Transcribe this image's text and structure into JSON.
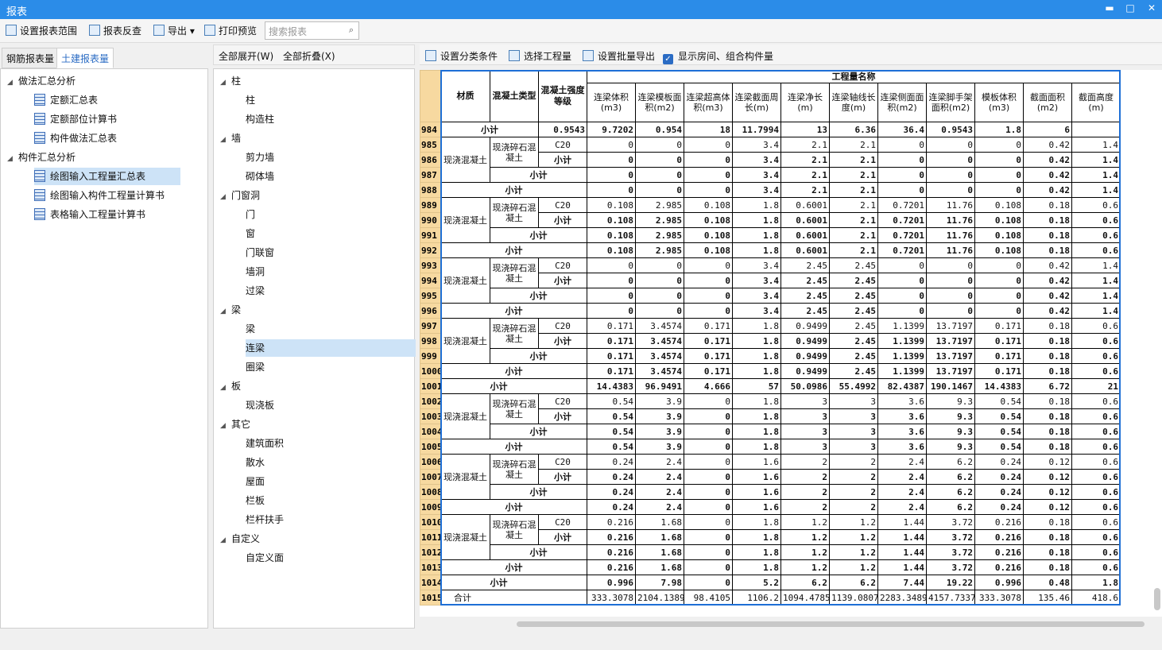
{
  "window": {
    "title": "报表",
    "btn_min": "▬",
    "btn_max": "□",
    "btn_close": "✕"
  },
  "toolbar": {
    "set_range": "设置报表范围",
    "reverse_check": "报表反查",
    "export": "导出",
    "export_arrow": "▾",
    "print_preview": "打印预览",
    "search_placeholder": "搜索报表",
    "search_icon": "⌕"
  },
  "left_tabs": [
    "钢筋报表量",
    "土建报表量"
  ],
  "left_tree": [
    {
      "label": "做法汇总分析",
      "level": 0,
      "expanded": true
    },
    {
      "label": "定额汇总表",
      "level": 1
    },
    {
      "label": "定额部位计算书",
      "level": 1
    },
    {
      "label": "构件做法汇总表",
      "level": 1
    },
    {
      "label": "构件汇总分析",
      "level": 0,
      "expanded": true
    },
    {
      "label": "绘图输入工程量汇总表",
      "level": 1,
      "selected": true
    },
    {
      "label": "绘图输入构件工程量计算书",
      "level": 1
    },
    {
      "label": "表格输入工程量计算书",
      "level": 1
    }
  ],
  "mid_header": {
    "expand_all": "全部展开(W)",
    "collapse_all": "全部折叠(X)"
  },
  "mid_tree": [
    {
      "label": "柱",
      "group": true
    },
    {
      "label": "柱"
    },
    {
      "label": "构造柱"
    },
    {
      "label": "墙",
      "group": true
    },
    {
      "label": "剪力墙"
    },
    {
      "label": "砌体墙"
    },
    {
      "label": "门窗洞",
      "group": true
    },
    {
      "label": "门"
    },
    {
      "label": "窗"
    },
    {
      "label": "门联窗"
    },
    {
      "label": "墙洞"
    },
    {
      "label": "过梁"
    },
    {
      "label": "梁",
      "group": true
    },
    {
      "label": "梁"
    },
    {
      "label": "连梁",
      "selected": true
    },
    {
      "label": "圈梁"
    },
    {
      "label": "板",
      "group": true
    },
    {
      "label": "现浇板"
    },
    {
      "label": "其它",
      "group": true
    },
    {
      "label": "建筑面积"
    },
    {
      "label": "散水"
    },
    {
      "label": "屋面"
    },
    {
      "label": "栏板"
    },
    {
      "label": "栏杆扶手"
    },
    {
      "label": "自定义",
      "group": true
    },
    {
      "label": "自定义面"
    }
  ],
  "right_toolbar": {
    "set_condition": "设置分类条件",
    "select_qty": "选择工程量",
    "batch_export": "设置批量导出",
    "show_rooms": "显示房间、组合构件量",
    "show_rooms_checked": true,
    "check_mark": "✓"
  },
  "table": {
    "group_header": "工程量名称",
    "headers": [
      "材质",
      "混凝土类型",
      "混凝土强度等级"
    ],
    "qty_headers": [
      "连梁体积(m3)",
      "连梁模板面积(m2)",
      "连梁超高体积(m3)",
      "连梁截面周长(m)",
      "连梁净长(m)",
      "连梁轴线长度(m)",
      "连梁侧面面积(m2)",
      "连梁脚手架面积(m2)",
      "模板体积(m3)",
      "截面面积(m2)",
      "截面高度(m)"
    ],
    "mat_text": "现浇混凝土",
    "conc_text": "现浇碎石混凝土",
    "subtotal": "小计",
    "total": "合计",
    "rows": [
      {
        "n": "984",
        "kind": "sub2",
        "v": [
          "0.9543",
          "9.7202",
          "0.954",
          "18",
          "11.7994",
          "13",
          "6.36",
          "36.4",
          "0.9543",
          "1.8",
          "6"
        ]
      },
      {
        "n": "985",
        "kind": "grade",
        "grade": "C20",
        "v": [
          "0",
          "0",
          "0",
          "3.4",
          "2.1",
          "2.1",
          "0",
          "0",
          "0",
          "0.42",
          "1.4"
        ]
      },
      {
        "n": "986",
        "kind": "sub3",
        "v": [
          "0",
          "0",
          "0",
          "3.4",
          "2.1",
          "2.1",
          "0",
          "0",
          "0",
          "0.42",
          "1.4"
        ]
      },
      {
        "n": "987",
        "kind": "sub2",
        "v": [
          "0",
          "0",
          "0",
          "3.4",
          "2.1",
          "2.1",
          "0",
          "0",
          "0",
          "0.42",
          "1.4"
        ]
      },
      {
        "n": "988",
        "kind": "sub1",
        "v": [
          "0",
          "0",
          "0",
          "3.4",
          "2.1",
          "2.1",
          "0",
          "0",
          "0",
          "0.42",
          "1.4"
        ]
      },
      {
        "n": "989",
        "kind": "grade",
        "grade": "C20",
        "v": [
          "0.108",
          "2.985",
          "0.108",
          "1.8",
          "0.6001",
          "2.1",
          "0.7201",
          "11.76",
          "0.108",
          "0.18",
          "0.6"
        ]
      },
      {
        "n": "990",
        "kind": "sub3",
        "v": [
          "0.108",
          "2.985",
          "0.108",
          "1.8",
          "0.6001",
          "2.1",
          "0.7201",
          "11.76",
          "0.108",
          "0.18",
          "0.6"
        ]
      },
      {
        "n": "991",
        "kind": "sub2",
        "v": [
          "0.108",
          "2.985",
          "0.108",
          "1.8",
          "0.6001",
          "2.1",
          "0.7201",
          "11.76",
          "0.108",
          "0.18",
          "0.6"
        ]
      },
      {
        "n": "992",
        "kind": "sub1",
        "v": [
          "0.108",
          "2.985",
          "0.108",
          "1.8",
          "0.6001",
          "2.1",
          "0.7201",
          "11.76",
          "0.108",
          "0.18",
          "0.6"
        ]
      },
      {
        "n": "993",
        "kind": "grade",
        "grade": "C20",
        "v": [
          "0",
          "0",
          "0",
          "3.4",
          "2.45",
          "2.45",
          "0",
          "0",
          "0",
          "0.42",
          "1.4"
        ]
      },
      {
        "n": "994",
        "kind": "sub3",
        "v": [
          "0",
          "0",
          "0",
          "3.4",
          "2.45",
          "2.45",
          "0",
          "0",
          "0",
          "0.42",
          "1.4"
        ]
      },
      {
        "n": "995",
        "kind": "sub2",
        "v": [
          "0",
          "0",
          "0",
          "3.4",
          "2.45",
          "2.45",
          "0",
          "0",
          "0",
          "0.42",
          "1.4"
        ]
      },
      {
        "n": "996",
        "kind": "sub1",
        "v": [
          "0",
          "0",
          "0",
          "3.4",
          "2.45",
          "2.45",
          "0",
          "0",
          "0",
          "0.42",
          "1.4"
        ]
      },
      {
        "n": "997",
        "kind": "grade",
        "grade": "C20",
        "v": [
          "0.171",
          "3.4574",
          "0.171",
          "1.8",
          "0.9499",
          "2.45",
          "1.1399",
          "13.7197",
          "0.171",
          "0.18",
          "0.6"
        ]
      },
      {
        "n": "998",
        "kind": "sub3",
        "v": [
          "0.171",
          "3.4574",
          "0.171",
          "1.8",
          "0.9499",
          "2.45",
          "1.1399",
          "13.7197",
          "0.171",
          "0.18",
          "0.6"
        ]
      },
      {
        "n": "999",
        "kind": "sub2",
        "v": [
          "0.171",
          "3.4574",
          "0.171",
          "1.8",
          "0.9499",
          "2.45",
          "1.1399",
          "13.7197",
          "0.171",
          "0.18",
          "0.6"
        ]
      },
      {
        "n": "1000",
        "kind": "sub1",
        "v": [
          "0.171",
          "3.4574",
          "0.171",
          "1.8",
          "0.9499",
          "2.45",
          "1.1399",
          "13.7197",
          "0.171",
          "0.18",
          "0.6"
        ]
      },
      {
        "n": "1001",
        "kind": "sub0",
        "v": [
          "14.4383",
          "96.9491",
          "4.666",
          "57",
          "50.0986",
          "55.4992",
          "82.4387",
          "190.1467",
          "14.4383",
          "6.72",
          "21"
        ]
      },
      {
        "n": "1002",
        "kind": "grade",
        "grade": "C20",
        "v": [
          "0.54",
          "3.9",
          "0",
          "1.8",
          "3",
          "3",
          "3.6",
          "9.3",
          "0.54",
          "0.18",
          "0.6"
        ]
      },
      {
        "n": "1003",
        "kind": "sub3",
        "v": [
          "0.54",
          "3.9",
          "0",
          "1.8",
          "3",
          "3",
          "3.6",
          "9.3",
          "0.54",
          "0.18",
          "0.6"
        ]
      },
      {
        "n": "1004",
        "kind": "sub2",
        "v": [
          "0.54",
          "3.9",
          "0",
          "1.8",
          "3",
          "3",
          "3.6",
          "9.3",
          "0.54",
          "0.18",
          "0.6"
        ]
      },
      {
        "n": "1005",
        "kind": "sub1",
        "v": [
          "0.54",
          "3.9",
          "0",
          "1.8",
          "3",
          "3",
          "3.6",
          "9.3",
          "0.54",
          "0.18",
          "0.6"
        ]
      },
      {
        "n": "1006",
        "kind": "grade",
        "grade": "C20",
        "v": [
          "0.24",
          "2.4",
          "0",
          "1.6",
          "2",
          "2",
          "2.4",
          "6.2",
          "0.24",
          "0.12",
          "0.6"
        ]
      },
      {
        "n": "1007",
        "kind": "sub3",
        "v": [
          "0.24",
          "2.4",
          "0",
          "1.6",
          "2",
          "2",
          "2.4",
          "6.2",
          "0.24",
          "0.12",
          "0.6"
        ]
      },
      {
        "n": "1008",
        "kind": "sub2",
        "v": [
          "0.24",
          "2.4",
          "0",
          "1.6",
          "2",
          "2",
          "2.4",
          "6.2",
          "0.24",
          "0.12",
          "0.6"
        ]
      },
      {
        "n": "1009",
        "kind": "sub1",
        "v": [
          "0.24",
          "2.4",
          "0",
          "1.6",
          "2",
          "2",
          "2.4",
          "6.2",
          "0.24",
          "0.12",
          "0.6"
        ]
      },
      {
        "n": "1010",
        "kind": "grade",
        "grade": "C20",
        "v": [
          "0.216",
          "1.68",
          "0",
          "1.8",
          "1.2",
          "1.2",
          "1.44",
          "3.72",
          "0.216",
          "0.18",
          "0.6"
        ]
      },
      {
        "n": "1011",
        "kind": "sub3",
        "v": [
          "0.216",
          "1.68",
          "0",
          "1.8",
          "1.2",
          "1.2",
          "1.44",
          "3.72",
          "0.216",
          "0.18",
          "0.6"
        ]
      },
      {
        "n": "1012",
        "kind": "sub2",
        "v": [
          "0.216",
          "1.68",
          "0",
          "1.8",
          "1.2",
          "1.2",
          "1.44",
          "3.72",
          "0.216",
          "0.18",
          "0.6"
        ]
      },
      {
        "n": "1013",
        "kind": "sub1",
        "v": [
          "0.216",
          "1.68",
          "0",
          "1.8",
          "1.2",
          "1.2",
          "1.44",
          "3.72",
          "0.216",
          "0.18",
          "0.6"
        ]
      },
      {
        "n": "1014",
        "kind": "sub0",
        "v": [
          "0.996",
          "7.98",
          "0",
          "5.2",
          "6.2",
          "6.2",
          "7.44",
          "19.22",
          "0.996",
          "0.48",
          "1.8"
        ]
      },
      {
        "n": "1015",
        "kind": "total",
        "v": [
          "333.3078",
          "2104.1389",
          "98.4105",
          "1106.2",
          "1094.4785",
          "1139.0807",
          "2283.3489",
          "4157.7337",
          "333.3078",
          "135.46",
          "418.6"
        ]
      }
    ]
  },
  "colors": {
    "titlebar": "#2b8ce8",
    "selected_row": "#cde3f7",
    "row_number_bg": "#f7d9a0",
    "frame": "#1e6fd6",
    "accent_text": "#2b6cc4"
  }
}
